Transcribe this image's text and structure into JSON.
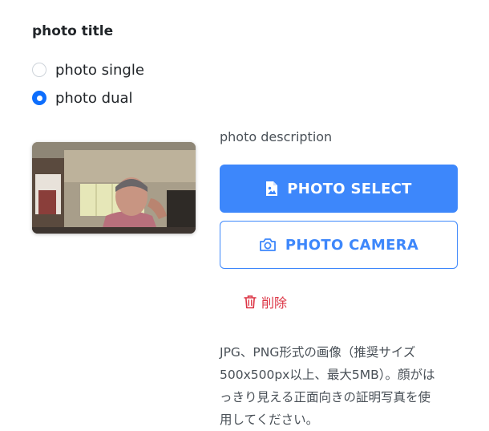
{
  "form": {
    "title": "photo title",
    "radio_options": [
      {
        "label": "photo single",
        "checked": false
      },
      {
        "label": "photo dual",
        "checked": true
      }
    ]
  },
  "photo_panel": {
    "description": "photo description",
    "select_button": {
      "label": "PHOTO SELECT",
      "icon": "image-file-icon"
    },
    "camera_button": {
      "label": "PHOTO CAMERA",
      "icon": "camera-icon"
    },
    "delete_link": {
      "label": "削除",
      "icon": "trash-icon"
    },
    "help_lines": [
      "JPG、PNG形式の画像（推奨サイズ",
      "500x500px以上、最大5MB）。顔がは",
      "っきり見える正面向きの証明写真を使",
      "用してください。"
    ]
  },
  "colors": {
    "accent": "#3d87fb",
    "danger": "#dc3545",
    "radio_checked": "#0d6efd"
  }
}
